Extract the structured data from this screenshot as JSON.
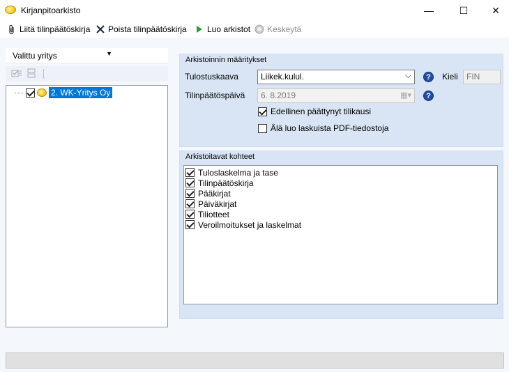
{
  "window": {
    "title": "Kirjanpitoarkisto",
    "minimize": "—",
    "maximize": "☐",
    "close": "✕"
  },
  "toolbar": {
    "attach_label": "Liitä tilinpäätöskirja",
    "remove_label": "Poista tilinpäätöskirja",
    "create_label": "Luo arkistot",
    "cancel_label": "Keskeytä"
  },
  "left": {
    "company_select": "Valittu yritys",
    "tree": [
      {
        "label": "2. WK-Yritys Oy",
        "checked": true,
        "selected": true
      }
    ]
  },
  "settings": {
    "group_title": "Arkistoinnin määritykset",
    "tulostuskaava_label": "Tulostuskaava",
    "tulostuskaava_value": "Liikek.kulul.",
    "kieli_label": "Kieli",
    "kieli_value": "FIN",
    "date_label": "Tilinpäätöspäivä",
    "date_value": "6.  8.2019",
    "previous_period_label": "Edellinen päättynyt tilikausi",
    "previous_period_checked": true,
    "no_pdf_label": "Älä luo laskuista PDF-tiedostoja",
    "no_pdf_checked": false
  },
  "items": {
    "group_title": "Arkistoitavat kohteet",
    "list": [
      {
        "label": "Tuloslaskelma ja tase",
        "checked": true
      },
      {
        "label": "Tilinpäätöskirja",
        "checked": true
      },
      {
        "label": "Pääkirjat",
        "checked": true
      },
      {
        "label": "Päiväkirjat",
        "checked": true
      },
      {
        "label": "Tiliotteet",
        "checked": true
      },
      {
        "label": "Veroilmoitukset ja laskelmat",
        "checked": true
      }
    ]
  },
  "colors": {
    "panel": "#d9e5f5",
    "selection": "#0078d7",
    "help_icon": "#1f4fa8"
  }
}
